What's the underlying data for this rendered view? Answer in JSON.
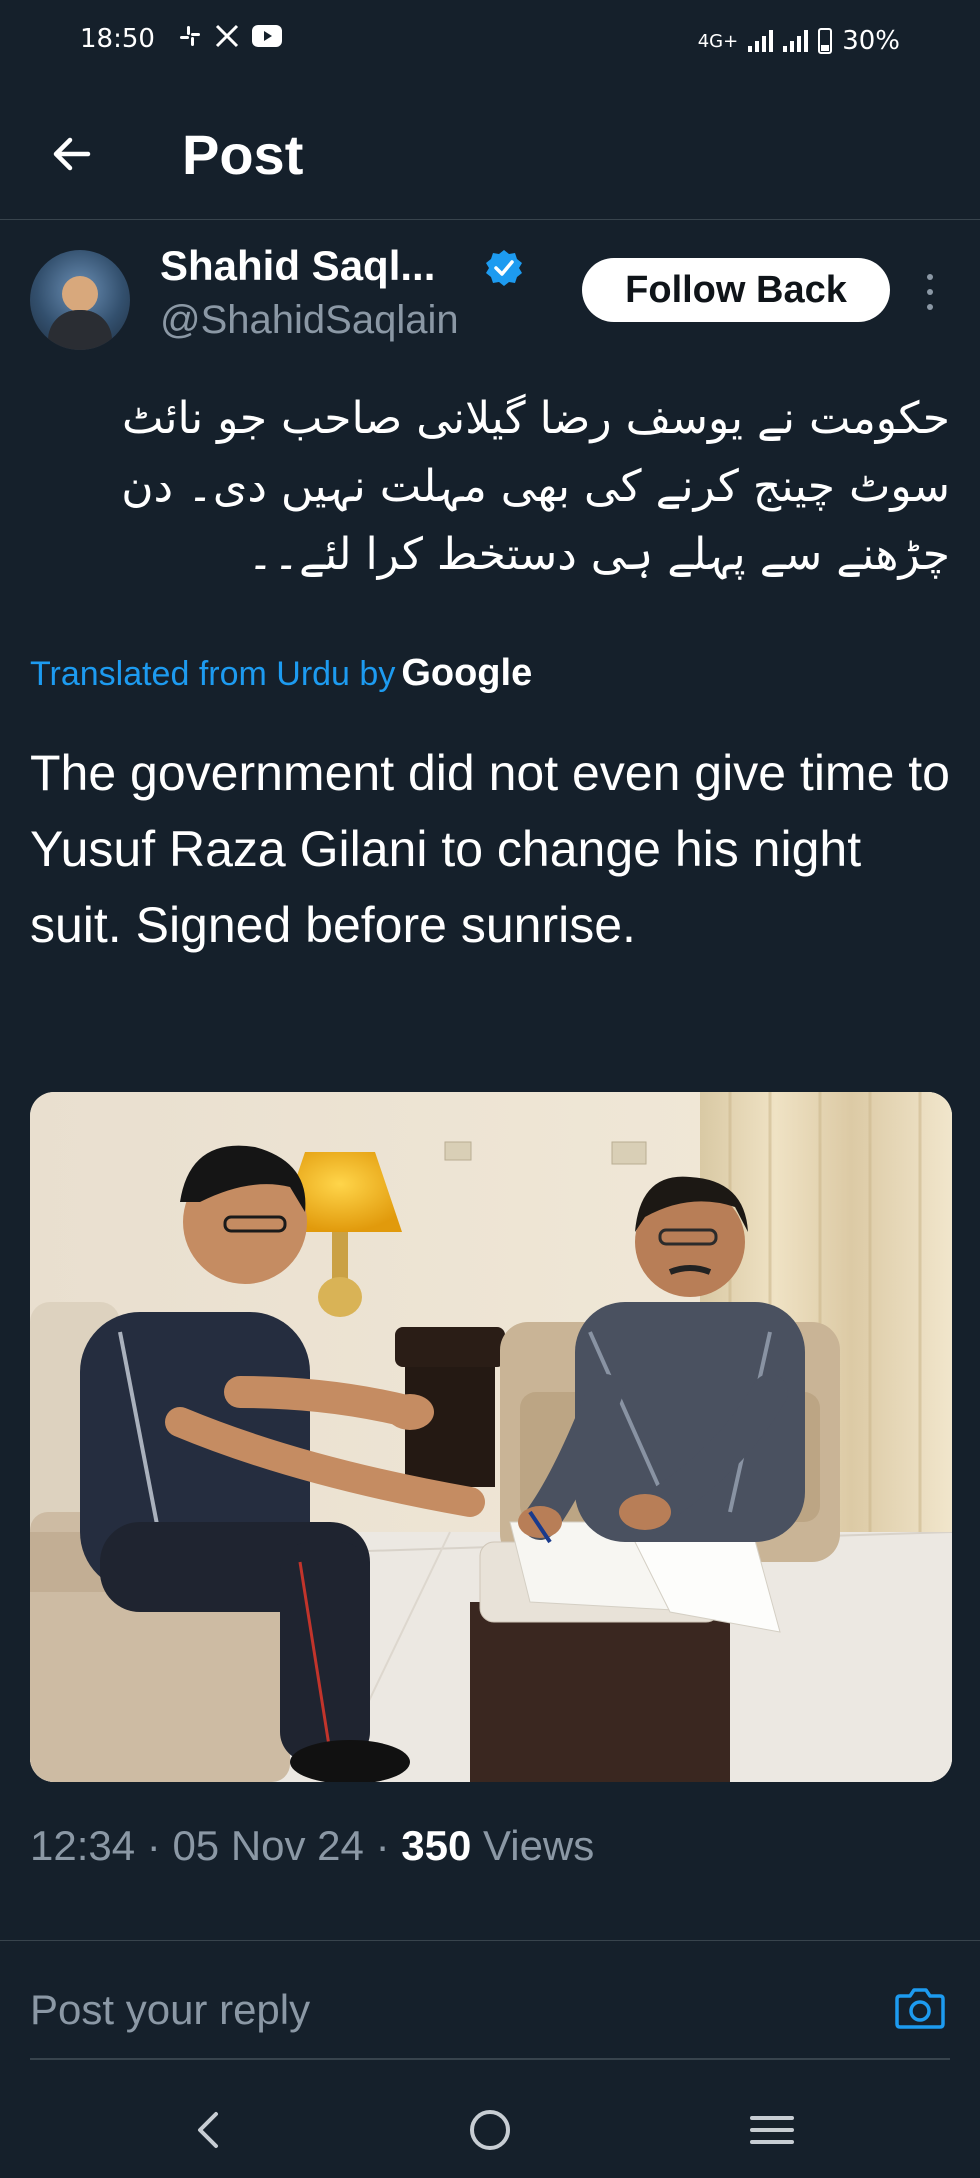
{
  "status_bar": {
    "time": "18:50",
    "network": "4G+",
    "battery": "30%"
  },
  "header": {
    "title": "Post"
  },
  "author": {
    "name": "Shahid Saql...",
    "handle": "@ShahidSaqlain",
    "verified_color": "#1d9bf0",
    "follow_label": "Follow Back"
  },
  "post": {
    "urdu_text": "حکومت نے یوسف رضا گیلانی صاحب جو نائٹ سوٹ چینج کرنے کی بھی مہلت نہیں دی۔ دن چڑھنے سے پہلے ہی دستخط کرا لئے۔۔",
    "translated_label": "Translated from Urdu by",
    "translated_provider": "Google",
    "english_text": "The government did not even give time to Yusuf Raza Gilani to change his night suit. Signed before sunrise.",
    "time": "12:34",
    "date": "05 Nov 24",
    "views_count": "350",
    "views_label": "Views"
  },
  "reply": {
    "placeholder": "Post your reply"
  },
  "colors": {
    "background": "#15202b",
    "accent": "#1d9bf0",
    "muted": "#8b98a5",
    "divider": "#38444d"
  },
  "icons": [
    "slack-icon",
    "x-icon",
    "youtube-icon",
    "back-arrow-icon",
    "verified-badge-icon",
    "more-vertical-icon",
    "camera-icon",
    "nav-back-icon",
    "nav-home-icon",
    "nav-recents-icon"
  ]
}
